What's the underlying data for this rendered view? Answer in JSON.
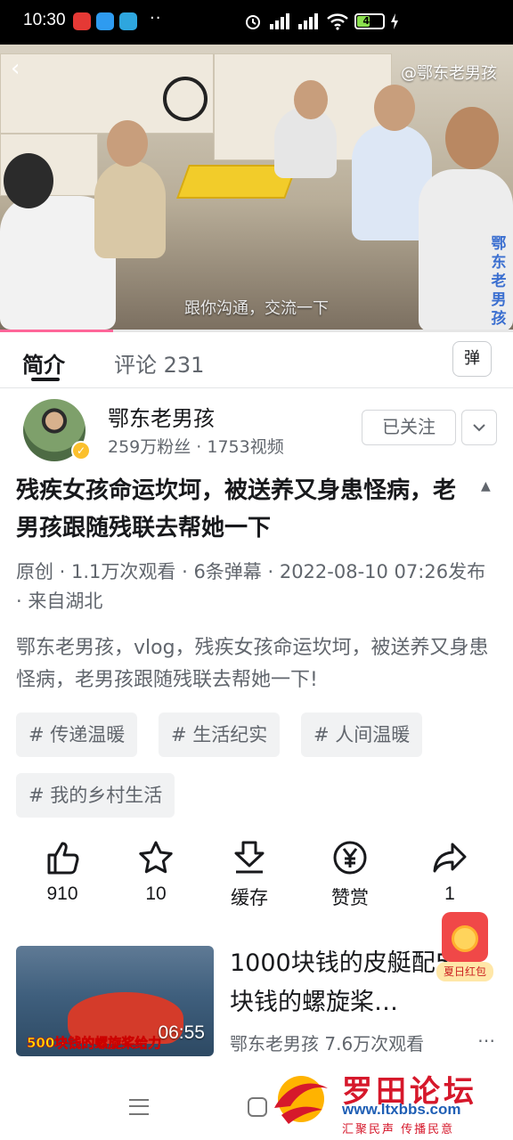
{
  "status_bar": {
    "time": "10:30",
    "battery": "49"
  },
  "video": {
    "watermark": "@鄂东老男孩",
    "side_mark": "鄂东老男孩",
    "caption": "跟你沟通，交流一下",
    "progress": 0.22
  },
  "tabs": {
    "intro": "简介",
    "comments": "评论 231",
    "danmaku_button": "弹"
  },
  "uploader": {
    "name": "鄂东老男孩",
    "stats": "259万粉丝 · 1753视频",
    "follow_label": "已关注"
  },
  "video_info": {
    "title": "残疾女孩命运坎坷，被送养又身患怪病，老男孩跟随残联去帮她一下",
    "meta": "原创 · 1.1万次观看 · 6条弹幕 · 2022-08-10 07:26发布 · 来自湖北",
    "description": "鄂东老男孩，vlog，残疾女孩命运坎坷，被送养又身患怪病，老男孩跟随残联去帮她一下!"
  },
  "tags": [
    "# 传递温暖",
    "# 生活纪实",
    "# 人间温暖",
    "# 我的乡村生活"
  ],
  "actions": {
    "like": "910",
    "favorite": "10",
    "cache": "缓存",
    "tip": "赞赏",
    "share": "1"
  },
  "recommended": {
    "title": "1000块钱的皮艇配500块钱的螺旋桨…",
    "thumb_caption": "500块钱的螺旋桨给力",
    "duration": "06:55",
    "meta": "鄂东老男孩  7.6万次观看",
    "more": "⋯"
  },
  "red_packet_label": "夏日红包",
  "watermark": {
    "title": "罗田论坛",
    "url": "www.ltxbbs.com",
    "slogan": "汇聚民声 传播民意"
  },
  "colors": {
    "accent": "#ff6699",
    "verified": "#fbc02d",
    "watermark_red": "#d6182b",
    "watermark_blue": "#1f5fb5"
  }
}
